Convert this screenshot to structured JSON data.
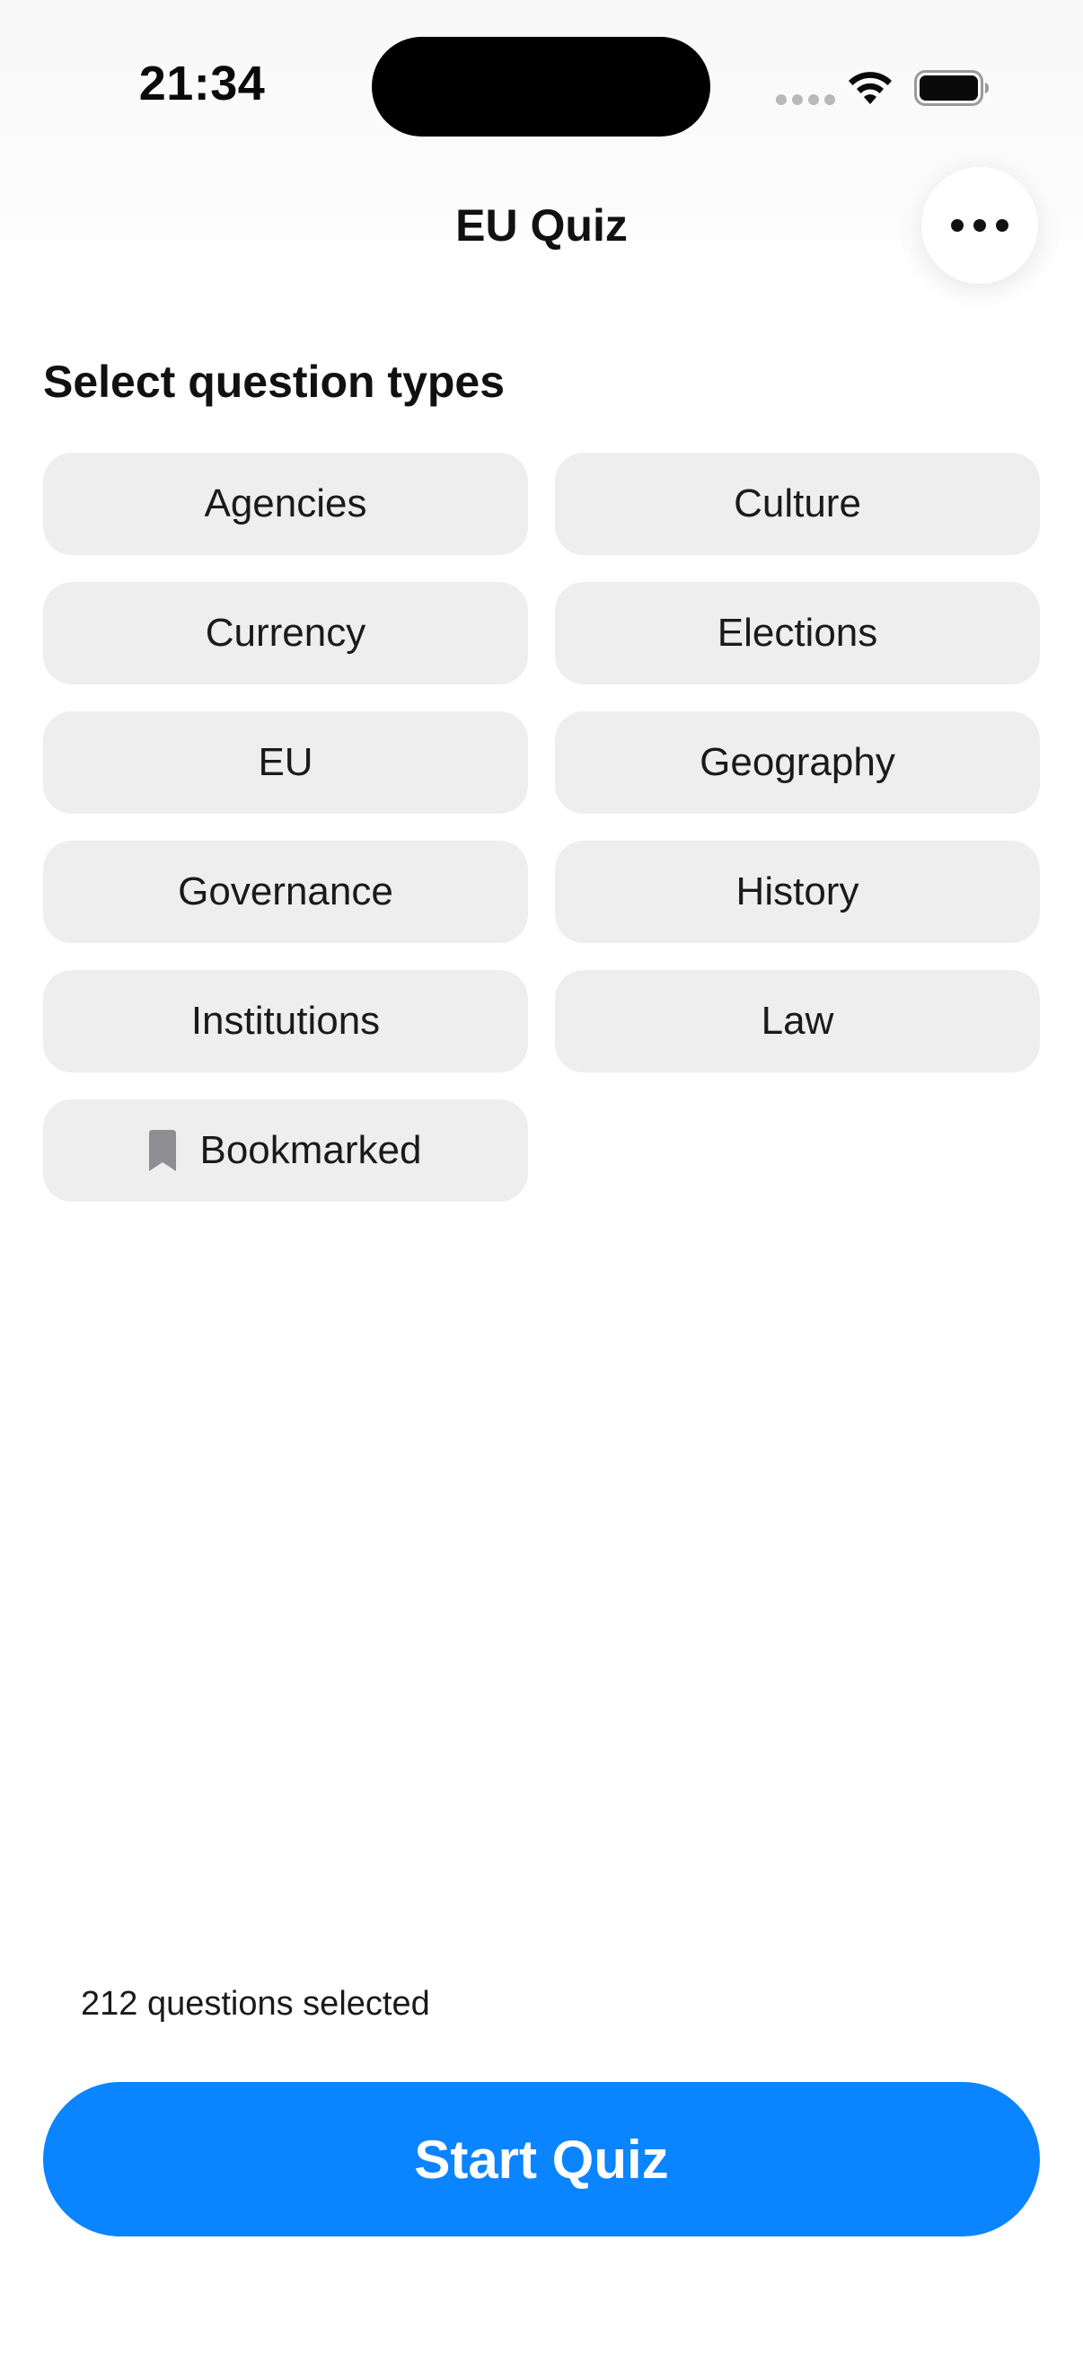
{
  "status_bar": {
    "time": "21:34"
  },
  "nav": {
    "title": "EU Quiz",
    "more_icon": "ellipsis-icon"
  },
  "section": {
    "heading": "Select question types"
  },
  "categories": [
    {
      "label": "Agencies"
    },
    {
      "label": "Culture"
    },
    {
      "label": "Currency"
    },
    {
      "label": "Elections"
    },
    {
      "label": "EU"
    },
    {
      "label": "Geography"
    },
    {
      "label": "Governance"
    },
    {
      "label": "History"
    },
    {
      "label": "Institutions"
    },
    {
      "label": "Law"
    },
    {
      "label": "Bookmarked",
      "icon": "bookmark-icon"
    }
  ],
  "footer": {
    "selected_count": "212 questions selected",
    "start_label": "Start Quiz"
  },
  "colors": {
    "accent": "#0a84ff",
    "chip_background": "#eeeeee",
    "bookmark_icon": "#8e8e93"
  }
}
